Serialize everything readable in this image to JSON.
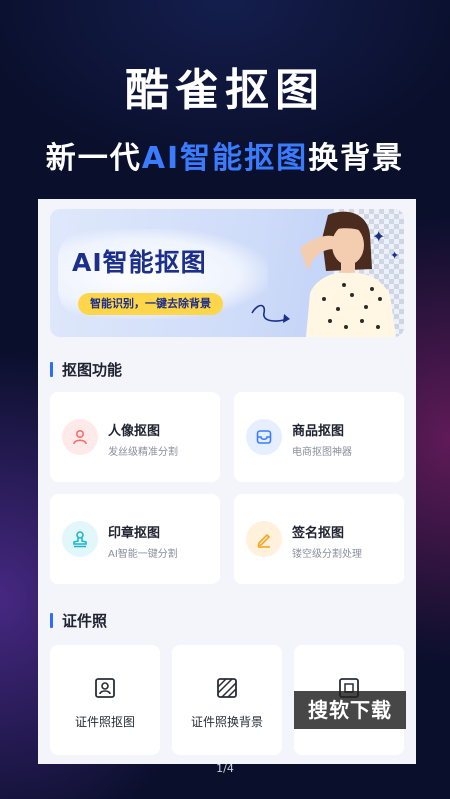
{
  "promo": {
    "title": "酷雀抠图",
    "subtitle_part1": "新一代",
    "subtitle_accent": "AI智能抠图",
    "subtitle_part2": "换背景",
    "accent_color": "#3a7cff"
  },
  "banner": {
    "title": "AI智能抠图",
    "pill": "智能识别，一键去除背景"
  },
  "sections": {
    "cutout_title": "抠图功能",
    "id_title": "证件照"
  },
  "features": [
    {
      "title": "人像抠图",
      "desc": "发丝级精准分割",
      "icon": "person-icon",
      "color": "#ff6b6b"
    },
    {
      "title": "商品抠图",
      "desc": "电商抠图神器",
      "icon": "box-icon",
      "color": "#3a7cff"
    },
    {
      "title": "印章抠图",
      "desc": "AI智能一键分割",
      "icon": "stamp-icon",
      "color": "#1fb6c9"
    },
    {
      "title": "签名抠图",
      "desc": "镂空级分割处理",
      "icon": "pen-icon",
      "color": "#f5a623"
    }
  ],
  "id_items": [
    {
      "title": "证件照抠图",
      "icon": "id-photo-icon"
    },
    {
      "title": "证件照换背景",
      "icon": "background-swap-icon"
    },
    {
      "title": "",
      "icon": "crop-icon"
    }
  ],
  "watermark": "搜软下载",
  "pager": "1/4"
}
